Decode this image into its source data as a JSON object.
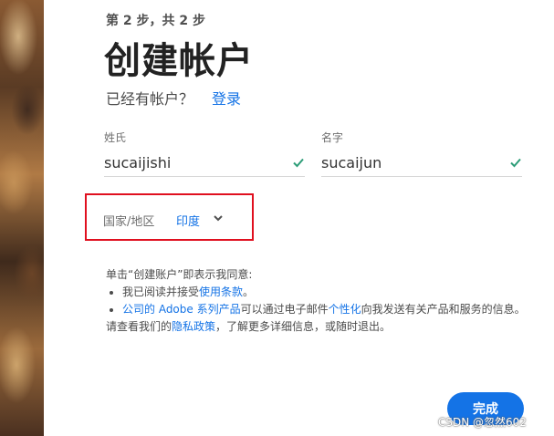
{
  "step": "第 2 步，共 2 步",
  "title": "创建帐户",
  "account_prompt": {
    "text": "已经有帐户？",
    "link": "登录"
  },
  "fields": {
    "last_name": {
      "label": "姓氏",
      "value": "sucaijishi"
    },
    "first_name": {
      "label": "名字",
      "value": "sucaijun"
    }
  },
  "country": {
    "label": "国家/地区",
    "value": "印度"
  },
  "consent": {
    "intro": "单击“创建账户”即表示我同意:",
    "item1_prefix": "我已阅读并接受",
    "item1_link": "使用条款",
    "item1_suffix": "。",
    "item2_link": "公司的 Adobe 系列产品",
    "item2_mid": "可以通过电子邮件",
    "item2_link2": "个性化",
    "item2_suffix": "向我发送有关产品和服务的信息。",
    "outro_prefix": "请查看我们的",
    "outro_link": "隐私政策",
    "outro_suffix": "，了解更多详细信息，或随时退出。"
  },
  "finish_button": "完成",
  "watermark": "CSDN @忽然602",
  "colors": {
    "accent": "#1473e6",
    "check": "#2d9d78",
    "highlight_box": "#e0101f"
  }
}
